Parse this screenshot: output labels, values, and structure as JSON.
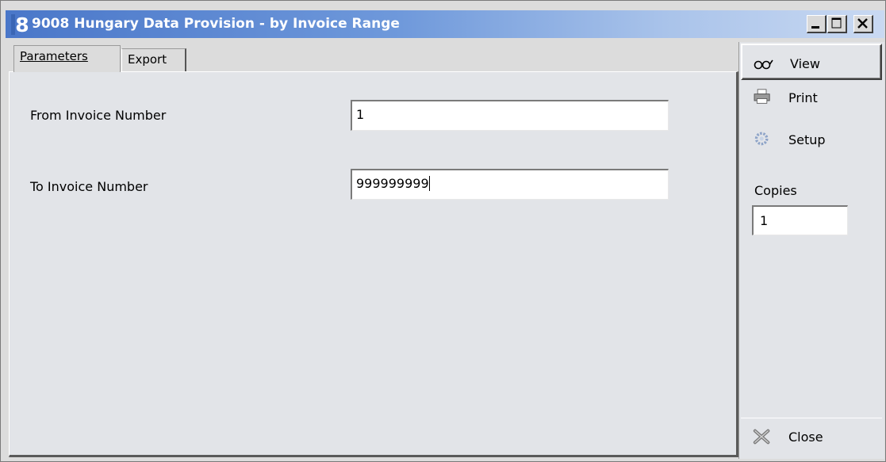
{
  "window": {
    "title": "9008 Hungary Data Provision - by Invoice Range",
    "app_icon_glyph": "8",
    "controls": [
      "minimize-icon",
      "maximize-icon",
      "close-icon"
    ]
  },
  "tabs": [
    {
      "label": "Parameters",
      "active": true
    },
    {
      "label": "Export",
      "active": false
    }
  ],
  "form": {
    "from_label": "From Invoice Number",
    "from_value": "1",
    "to_label": "To Invoice Number",
    "to_value": "999999999"
  },
  "sidebar": {
    "view_label": "View",
    "print_label": "Print",
    "setup_label": "Setup",
    "copies_label": "Copies",
    "copies_value": "1",
    "close_label": "Close"
  },
  "colors": {
    "titlebar_start": "#4a77c9",
    "titlebar_end": "#c9d9f2",
    "panel_bg": "#e2e4e8"
  }
}
